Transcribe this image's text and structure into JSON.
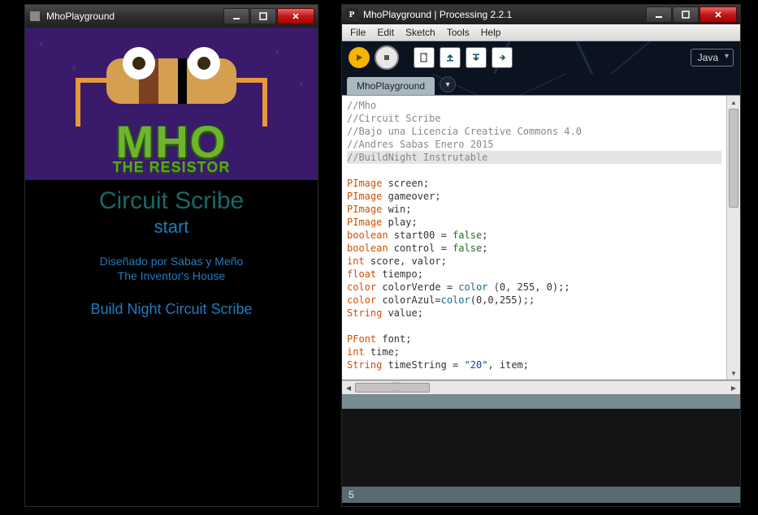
{
  "game_window": {
    "title": "MhoPlayground",
    "hero": {
      "logo_big": "MHO",
      "logo_sub": "THE RESISTOR"
    },
    "text": {
      "circuit_scribe": "Circuit Scribe",
      "start": "start",
      "credit1": "Diseñado por Sabas y Meño",
      "credit2": "The Inventor's House",
      "build": "Build Night Circuit Scribe"
    }
  },
  "ide_window": {
    "title": "MhoPlayground | Processing 2.2.1",
    "app_icon_letter": "P",
    "menu": {
      "file": "File",
      "edit": "Edit",
      "sketch": "Sketch",
      "tools": "Tools",
      "help": "Help"
    },
    "mode": "Java",
    "tab": "MhoPlayground",
    "status_line": "5",
    "code": {
      "c1": "//Mho",
      "c2": "//Circuit Scribe",
      "c3": "//Bajo una Licencia Creative Commons 4.0",
      "c4": "//Andres Sabas Enero 2015",
      "c5": "//BuildNight Instrutable",
      "l_pimage": "PImage",
      "v_screen": " screen;",
      "v_gameover": " gameover;",
      "v_win": " win;",
      "v_play": " play;",
      "l_boolean": "boolean",
      "v_start00a": " start00 = ",
      "v_start00b": ";",
      "v_controla": " control = ",
      "kw_false": "false",
      "l_int": "int",
      "v_score": " score, valor;",
      "l_float": "float",
      "v_tiempo": " tiempo;",
      "l_color": "color",
      "v_verdeA": " colorVerde = ",
      "fn_color": "color",
      "v_verdeB": " (0, 255, 0);;",
      "v_azulA": " colorAzul=",
      "v_azulB": "(0,0,255);;",
      "l_string": "String",
      "v_value": " value;",
      "l_pfont": "PFont",
      "v_font": " font;",
      "v_time": " time;",
      "v_tsA": " timeString = ",
      "str_20": "\"20\"",
      "v_tsB": ", item;"
    }
  }
}
